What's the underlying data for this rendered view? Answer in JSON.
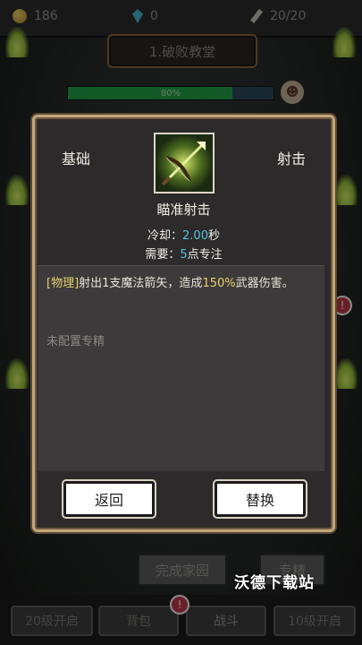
{
  "resources": {
    "gold": "186",
    "gems": "0",
    "stamina": "20/20"
  },
  "title_plate": "1.破败教堂",
  "progress": {
    "text": "80%",
    "value": 0.8
  },
  "background_buttons": {
    "left": "完成家园",
    "right": "专精"
  },
  "bottom_nav": {
    "item1": "20级开启",
    "item2": "背包",
    "item3": "战斗",
    "item4": "10级开启"
  },
  "badge": "!",
  "watermark": "沃德下载站",
  "dialog": {
    "left_label": "基础",
    "right_label": "射击",
    "skill_name": "瞄准射击",
    "cooldown_label": "冷却：",
    "cooldown_value": "2.00",
    "cooldown_unit": "秒",
    "requirement_label": "需要：",
    "requirement_value": "5",
    "requirement_unit": "点专注",
    "desc_tag": "[物理]",
    "desc_part1": "射出1支魔法箭矢，造成",
    "desc_pct": "150%",
    "desc_part2": "武器伤害。",
    "note": "未配置专精",
    "back_button": "返回",
    "replace_button": "替换"
  },
  "colors": {
    "accent_cyan": "#4fc3e0",
    "accent_yellow": "#e9d26a",
    "frame_gold": "#c3a57a"
  },
  "icons": [
    "coin-icon",
    "gem-icon",
    "feather-icon",
    "demon-mask-icon",
    "crossbow-skill-icon"
  ]
}
